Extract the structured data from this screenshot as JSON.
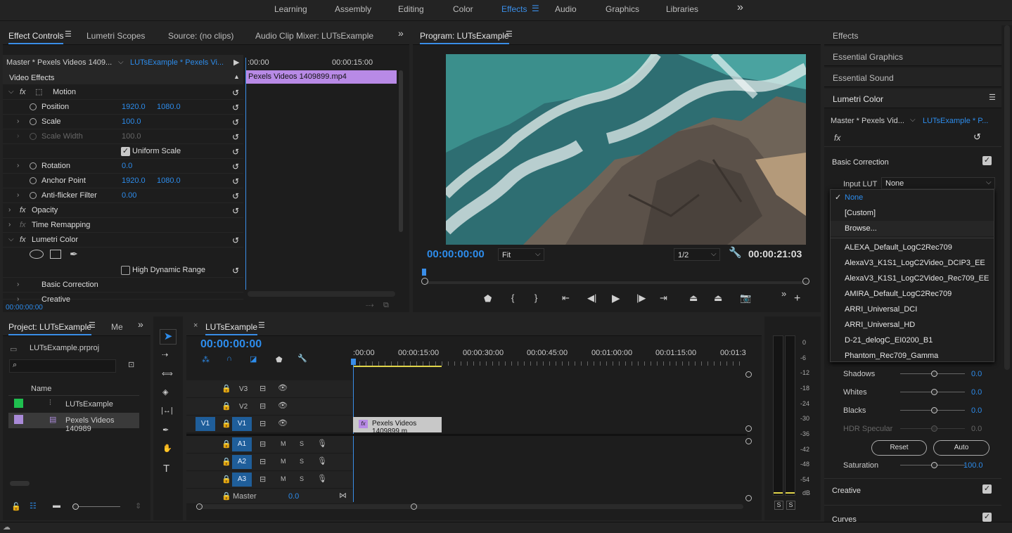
{
  "workspaces": [
    "Learning",
    "Assembly",
    "Editing",
    "Color",
    "Effects",
    "Audio",
    "Graphics",
    "Libraries"
  ],
  "workspace_active": "Effects",
  "more_icon": "»",
  "effect_controls": {
    "tabs": [
      "Effect Controls",
      "Lumetri Scopes",
      "Source: (no clips)",
      "Audio Clip Mixer: LUTsExample"
    ],
    "master_clip": "Master * Pexels Videos 1409...",
    "seq_clip": "LUTsExample * Pexels Vi...",
    "time_start": ":00:00",
    "time_mid": "00:00:15:00",
    "clip_name": "Pexels Videos 1409899.mp4",
    "section": "Video Effects",
    "motion": "Motion",
    "position_label": "Position",
    "position_x": "1920.0",
    "position_y": "1080.0",
    "scale_label": "Scale",
    "scale_val": "100.0",
    "scale_width_label": "Scale Width",
    "scale_width_val": "100.0",
    "uniform_scale": "Uniform Scale",
    "rotation_label": "Rotation",
    "rotation_val": "0.0",
    "anchor_label": "Anchor Point",
    "anchor_x": "1920.0",
    "anchor_y": "1080.0",
    "antiflicker_label": "Anti-flicker Filter",
    "antiflicker_val": "0.00",
    "opacity": "Opacity",
    "time_remap": "Time Remapping",
    "lumetri": "Lumetri Color",
    "hdr": "High Dynamic Range",
    "basic_correction": "Basic Correction",
    "creative": "Creative",
    "timecode": "00:00:00:00"
  },
  "program": {
    "title": "Program: LUTsExample",
    "timecode": "00:00:00:00",
    "fit": "Fit",
    "resolution": "1/2",
    "duration": "00:00:21:03"
  },
  "right_panel": {
    "items": [
      "Effects",
      "Essential Graphics",
      "Essential Sound"
    ],
    "lumetri_title": "Lumetri Color",
    "master": "Master * Pexels Vid...",
    "seq": "LUTsExample * P...",
    "basic_correction": "Basic Correction",
    "input_lut_label": "Input LUT",
    "input_lut_value": "None",
    "lut_options": [
      "None",
      "[Custom]",
      "Browse...",
      "ALEXA_Default_LogC2Rec709",
      "AlexaV3_K1S1_LogC2Video_DCIP3_EE",
      "AlexaV3_K1S1_LogC2Video_Rec709_EE",
      "AMIRA_Default_LogC2Rec709",
      "ARRI_Universal_DCI",
      "ARRI_Universal_HD",
      "D-21_delogC_EI0200_B1",
      "Phantom_Rec709_Gamma"
    ],
    "shadows": "Shadows",
    "shadows_val": "0.0",
    "whites": "Whites",
    "whites_val": "0.0",
    "blacks": "Blacks",
    "blacks_val": "0.0",
    "hdr_specular": "HDR Specular",
    "hdr_specular_val": "0.0",
    "reset_btn": "Reset",
    "auto_btn": "Auto",
    "saturation": "Saturation",
    "saturation_val": "100.0",
    "creative": "Creative",
    "curves": "Curves"
  },
  "project": {
    "tab": "Project: LUTsExample",
    "tab2": "Me",
    "file": "LUTsExample.prproj",
    "col_name": "Name",
    "items": [
      "LUTsExample",
      "Pexels Videos 140989"
    ]
  },
  "timeline": {
    "title": "LUTsExample",
    "timecode": "00:00:00:00",
    "ruler": [
      ":00:00",
      "00:00:15:00",
      "00:00:30:00",
      "00:00:45:00",
      "00:01:00:00",
      "00:01:15:00",
      "00:01:3"
    ],
    "video_tracks": [
      "V3",
      "V2",
      "V1"
    ],
    "audio_tracks": [
      "A1",
      "A2",
      "A3"
    ],
    "source_v1": "V1",
    "master": "Master",
    "master_val": "0.0",
    "clip": "Pexels Videos 1409899.m"
  },
  "meter": {
    "scale": [
      "0",
      "-6",
      "-12",
      "-18",
      "-24",
      "-30",
      "-36",
      "-42",
      "-48",
      "-54",
      "dB"
    ],
    "solo": "S"
  },
  "colors": {
    "accent": "#2d8ceb",
    "clip_purple": "#b88ae6",
    "track_blue": "#1f5e9a",
    "label_green": "#1fbf4f",
    "label_lavender": "#a98ad8"
  }
}
